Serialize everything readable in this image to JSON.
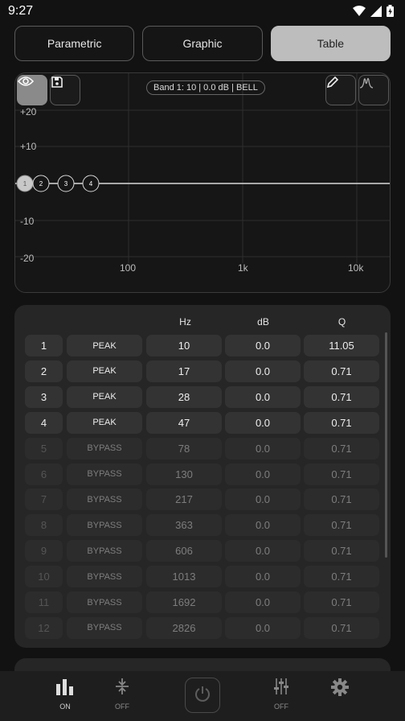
{
  "status": {
    "time": "9:27"
  },
  "tabs": [
    {
      "label": "Parametric"
    },
    {
      "label": "Graphic"
    },
    {
      "label": "Table"
    }
  ],
  "graph": {
    "band_label": "Band 1: 10 | 0.0 dB | BELL",
    "y_ticks": [
      "+20",
      "+10",
      "-10",
      "-20"
    ],
    "x_ticks": [
      "100",
      "1k",
      "10k"
    ],
    "nodes": [
      "1",
      "2",
      "3",
      "4"
    ]
  },
  "table": {
    "headers": {
      "hz": "Hz",
      "db": "dB",
      "q": "Q"
    },
    "rows": [
      {
        "num": "1",
        "type": "PEAK",
        "hz": "10",
        "db": "0.0",
        "q": "11.05",
        "active": true
      },
      {
        "num": "2",
        "type": "PEAK",
        "hz": "17",
        "db": "0.0",
        "q": "0.71",
        "active": true
      },
      {
        "num": "3",
        "type": "PEAK",
        "hz": "28",
        "db": "0.0",
        "q": "0.71",
        "active": true
      },
      {
        "num": "4",
        "type": "PEAK",
        "hz": "47",
        "db": "0.0",
        "q": "0.71",
        "active": true
      },
      {
        "num": "5",
        "type": "BYPASS",
        "hz": "78",
        "db": "0.0",
        "q": "0.71",
        "active": false
      },
      {
        "num": "6",
        "type": "BYPASS",
        "hz": "130",
        "db": "0.0",
        "q": "0.71",
        "active": false
      },
      {
        "num": "7",
        "type": "BYPASS",
        "hz": "217",
        "db": "0.0",
        "q": "0.71",
        "active": false
      },
      {
        "num": "8",
        "type": "BYPASS",
        "hz": "363",
        "db": "0.0",
        "q": "0.71",
        "active": false
      },
      {
        "num": "9",
        "type": "BYPASS",
        "hz": "606",
        "db": "0.0",
        "q": "0.71",
        "active": false
      },
      {
        "num": "10",
        "type": "BYPASS",
        "hz": "1013",
        "db": "0.0",
        "q": "0.71",
        "active": false
      },
      {
        "num": "11",
        "type": "BYPASS",
        "hz": "1692",
        "db": "0.0",
        "q": "0.71",
        "active": false
      },
      {
        "num": "12",
        "type": "BYPASS",
        "hz": "2826",
        "db": "0.0",
        "q": "0.71",
        "active": false
      }
    ]
  },
  "bottom_nav": {
    "eq_label": "ON",
    "compressor_label": "OFF",
    "mixer_label": "OFF"
  }
}
